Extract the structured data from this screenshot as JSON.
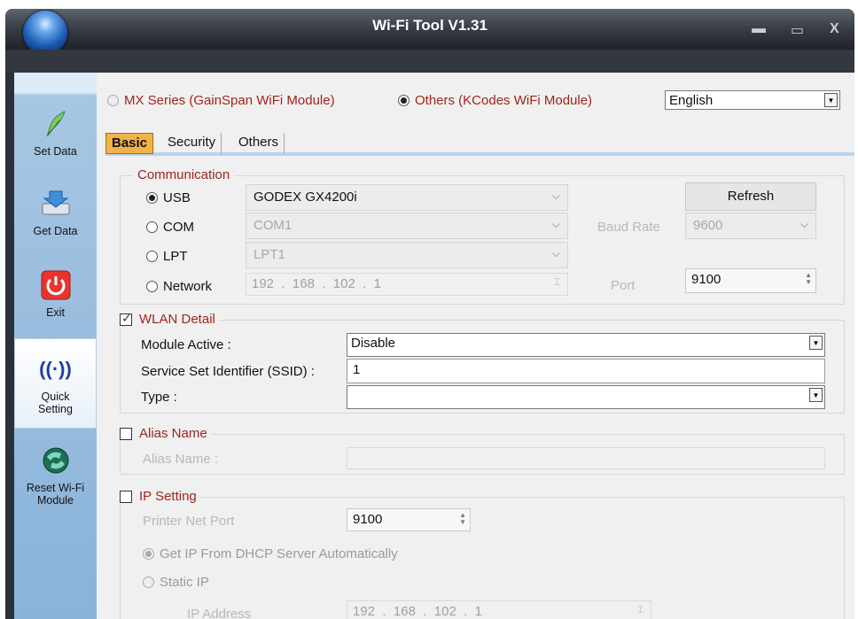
{
  "window": {
    "title": "Wi-Fi Tool V1.31"
  },
  "sidebar": {
    "items": [
      {
        "label": "Set Data"
      },
      {
        "label": "Get Data"
      },
      {
        "label": "Exit"
      },
      {
        "label": "Quick Setting"
      },
      {
        "label": "Reset Wi-Fi Module"
      }
    ]
  },
  "module": {
    "mx_label": "MX Series (GainSpan WiFi Module)",
    "others_label": "Others (KCodes WiFi Module)",
    "language": "English"
  },
  "tabs": [
    "Basic",
    "Security",
    "Others"
  ],
  "communication": {
    "title": "Communication",
    "usb_label": "USB",
    "usb_value": "GODEX GX4200i",
    "com_label": "COM",
    "com_value": "COM1",
    "lpt_label": "LPT",
    "lpt_value": "LPT1",
    "network_label": "Network",
    "ip": [
      "192",
      "168",
      "102",
      "1"
    ],
    "refresh_label": "Refresh",
    "baud_label": "Baud Rate",
    "baud_value": "9600",
    "port_label": "Port",
    "port_value": "9100"
  },
  "wlan": {
    "title": "WLAN Detail",
    "module_active_label": "Module Active :",
    "module_active_value": "Disable",
    "ssid_label": "Service Set Identifier (SSID) :",
    "ssid_value": "1",
    "type_label": "Type :",
    "type_value": ""
  },
  "alias": {
    "title": "Alias Name",
    "label": "Alias Name :",
    "value": ""
  },
  "ip_setting": {
    "title": "IP Setting",
    "port_label": "Printer Net Port",
    "port_value": "9100",
    "dhcp_label": "Get IP From DHCP Server Automatically",
    "static_label": "Static IP",
    "ip_address_label": "IP Address",
    "ip": [
      "192",
      "168",
      "102",
      "1"
    ]
  }
}
